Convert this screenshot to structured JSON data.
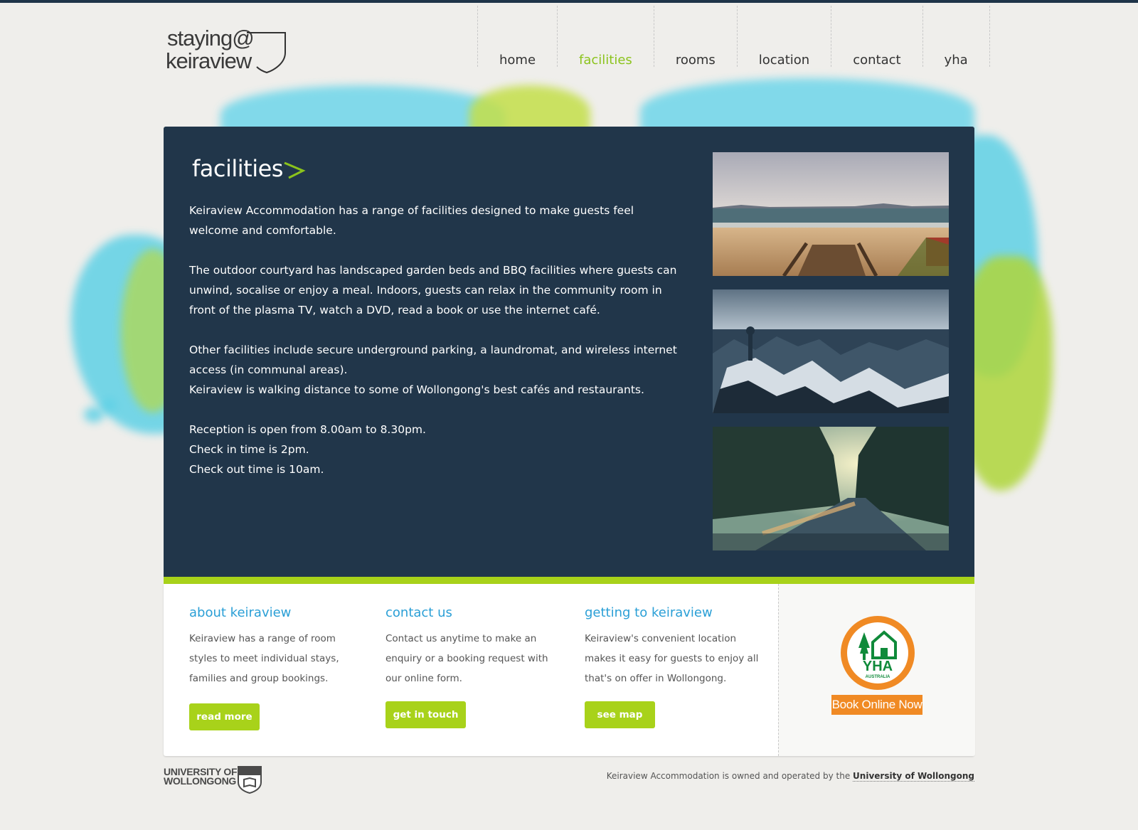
{
  "logo": {
    "line1": "staying@",
    "line2": "keiraview"
  },
  "nav": [
    {
      "label": "home"
    },
    {
      "label": "facilities"
    },
    {
      "label": "rooms"
    },
    {
      "label": "location"
    },
    {
      "label": "contact"
    },
    {
      "label": "yha"
    }
  ],
  "nav_active": "facilities",
  "main": {
    "title": "facilities",
    "paragraphs": [
      "Keiraview Accommodation has a range of facilities designed to make guests feel welcome and comfortable.",
      "The outdoor courtyard has landscaped garden beds and BBQ facilities where guests can unwind, socalise or enjoy a meal. Indoors, guests can relax in the community room in front of the plasma TV, watch a DVD, read a book or use the internet café.",
      "Other facilities include secure underground parking, a laundromat, and wireless internet access (in communal areas).",
      "Keiraview is walking distance to some of Wollongong's best cafés and restaurants.",
      "Reception is open from 8.00am to 8.30pm.",
      "Check in time is 2pm.",
      "Check out time is 10am."
    ]
  },
  "columns": [
    {
      "heading": "about keiraview",
      "text": "Keiraview has a range of room styles to meet individual stays, families and group bookings.",
      "button": "read more"
    },
    {
      "heading": "contact us",
      "text": "Contact us anytime to make an enquiry or a booking request with our online form.",
      "button": "get in touch"
    },
    {
      "heading": "getting to keiraview",
      "text": "Keiraview's convenient location makes it easy for guests to enjoy all that's on offer in Wollongong.",
      "button": "see map"
    }
  ],
  "yha": {
    "logo_text": "YHA",
    "logo_subtext": "AUSTRALIA",
    "book_button": "Book Online Now"
  },
  "footer": {
    "uow_line1": "UNIVERSITY OF",
    "uow_line2": "WOLLONGONG",
    "note_prefix": "Keiraview Accommodation is owned and operated by the",
    "note_link": "University of Wollongong"
  },
  "colors": {
    "panel": "#21364a",
    "accent_green": "#a8d21a",
    "heading_blue": "#2a9fd6",
    "yha_orange": "#f08a24",
    "yha_green": "#0f8a3a"
  }
}
